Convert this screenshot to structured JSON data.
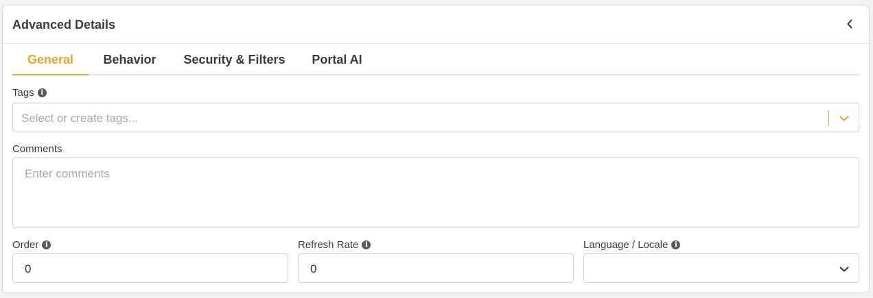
{
  "panel": {
    "title": "Advanced Details",
    "collapse_icon": "chevron-left-icon"
  },
  "tabs": [
    {
      "label": "General",
      "active": true
    },
    {
      "label": "Behavior",
      "active": false
    },
    {
      "label": "Security & Filters",
      "active": false
    },
    {
      "label": "Portal AI",
      "active": false
    }
  ],
  "form": {
    "tags": {
      "label": "Tags",
      "placeholder": "Select or create tags...",
      "info_icon": "info-icon",
      "dropdown_icon": "chevron-down-icon"
    },
    "comments": {
      "label": "Comments",
      "placeholder": "Enter comments"
    },
    "order": {
      "label": "Order",
      "value": "0",
      "info_icon": "info-icon"
    },
    "refresh_rate": {
      "label": "Refresh Rate",
      "value": "0",
      "info_icon": "info-icon"
    },
    "language_locale": {
      "label": "Language / Locale",
      "value": "",
      "info_icon": "info-icon",
      "dropdown_icon": "chevron-down-icon"
    }
  },
  "colors": {
    "accent": "#eea52a",
    "text": "#3a3a3a",
    "border": "#cfcfcf"
  }
}
